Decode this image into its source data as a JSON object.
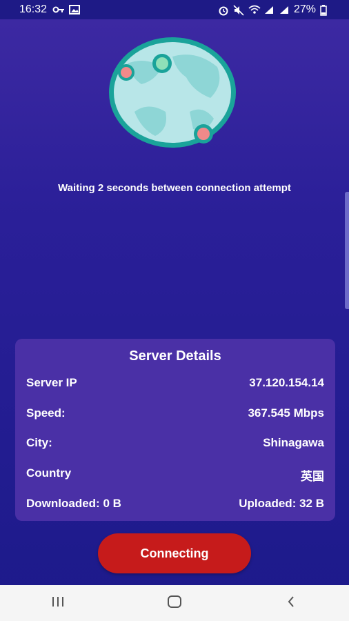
{
  "status_bar": {
    "time": "16:32",
    "battery": "27%"
  },
  "main": {
    "wait_message": "Waiting 2 seconds between connection attempt"
  },
  "server_details": {
    "title": "Server Details",
    "rows": [
      {
        "label": "Server IP",
        "value": "37.120.154.14"
      },
      {
        "label": "Speed:",
        "value": "367.545 Mbps"
      },
      {
        "label": "City:",
        "value": "Shinagawa"
      },
      {
        "label": "Country",
        "value": "英国"
      },
      {
        "label": "Downloaded: 0 B",
        "value": "Uploaded: 32 B"
      }
    ]
  },
  "connect_button": {
    "label": "Connecting"
  },
  "icons": {
    "globe": "globe-icon",
    "status": [
      "key-icon",
      "image-icon",
      "alarm-icon",
      "mute-icon",
      "wifi-icon",
      "signal-icon",
      "battery-icon"
    ],
    "nav": [
      "recents-icon",
      "home-icon",
      "back-icon"
    ]
  },
  "colors": {
    "accent_button": "#c61b1b",
    "card_background": "#4a30a6",
    "background": "#2a1f98"
  }
}
